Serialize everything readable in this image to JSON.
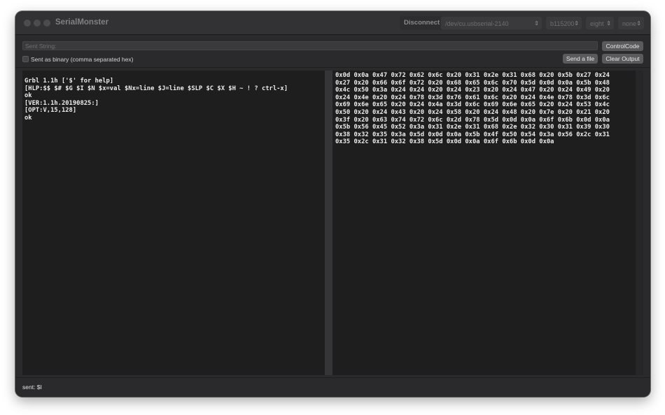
{
  "window": {
    "title": "SerialMonster"
  },
  "titlebar": {
    "disconnect_label": "Disconnect",
    "port_value": "/dev/cu.usbserial-2140",
    "baud_value": "b115200",
    "databits_value": "eight",
    "parity_value": "none"
  },
  "toolbar": {
    "sent_string_placeholder": "Sent String:",
    "controlcode_label": "ControlCode",
    "binary_checkbox_label": "Sent as binary (comma separated hex)",
    "binary_checked": false,
    "send_file_label": "Send a file",
    "clear_output_label": "Clear Output"
  },
  "output": {
    "text_lines": [
      "Grbl 1.1h ['$' for help]",
      "[HLP:$$ $# $G $I $N $x=val $Nx=line $J=line $SLP $C $X $H ~ ! ? ctrl-x]",
      "ok",
      "[VER:1.1h.20190825:]",
      "[OPT:V,15,128]",
      "ok"
    ],
    "hex_lines": [
      "0x0d 0x0a 0x47 0x72 0x62 0x6c 0x20 0x31 0x2e 0x31 0x68 0x20 0x5b 0x27 0x24",
      "0x27 0x20 0x66 0x6f 0x72 0x20 0x68 0x65 0x6c 0x70 0x5d 0x0d 0x0a 0x5b 0x48",
      "0x4c 0x50 0x3a 0x24 0x24 0x20 0x24 0x23 0x20 0x24 0x47 0x20 0x24 0x49 0x20",
      "0x24 0x4e 0x20 0x24 0x78 0x3d 0x76 0x61 0x6c 0x20 0x24 0x4e 0x78 0x3d 0x6c",
      "0x69 0x6e 0x65 0x20 0x24 0x4a 0x3d 0x6c 0x69 0x6e 0x65 0x20 0x24 0x53 0x4c",
      "0x50 0x20 0x24 0x43 0x20 0x24 0x58 0x20 0x24 0x48 0x20 0x7e 0x20 0x21 0x20",
      "0x3f 0x20 0x63 0x74 0x72 0x6c 0x2d 0x78 0x5d 0x0d 0x0a 0x6f 0x6b 0x0d 0x0a",
      "0x5b 0x56 0x45 0x52 0x3a 0x31 0x2e 0x31 0x68 0x2e 0x32 0x30 0x31 0x39 0x30",
      "0x38 0x32 0x35 0x3a 0x5d 0x0d 0x0a 0x5b 0x4f 0x50 0x54 0x3a 0x56 0x2c 0x31",
      "0x35 0x2c 0x31 0x32 0x38 0x5d 0x0d 0x0a 0x6f 0x6b 0x0d 0x0a"
    ]
  },
  "status": {
    "text": "sent: $I"
  }
}
